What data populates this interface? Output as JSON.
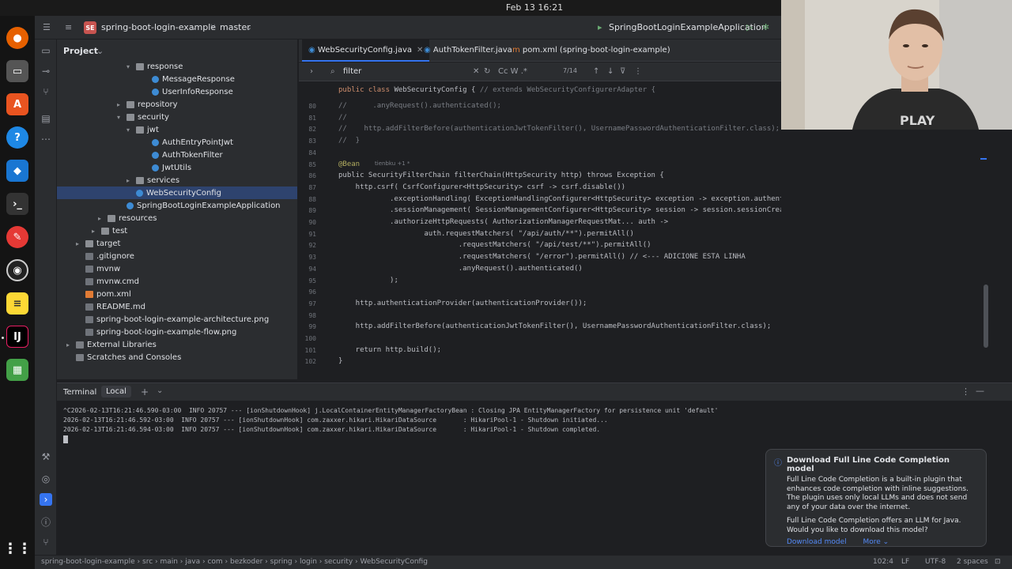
{
  "system": {
    "clock": "Feb 13  16:21"
  },
  "header": {
    "project_badge": "SE",
    "project_name": "spring-boot-login-example",
    "branch": "master",
    "run_config": "SpringBootLoginExampleApplication"
  },
  "project_panel": {
    "title": "Project",
    "items": [
      {
        "label": "response",
        "kind": "folder",
        "arrow": "▾"
      },
      {
        "label": "MessageResponse",
        "kind": "cls",
        "arrow": ""
      },
      {
        "label": "UserInfoResponse",
        "kind": "cls",
        "arrow": ""
      },
      {
        "label": "repository",
        "kind": "folder",
        "arrow": "▸"
      },
      {
        "label": "security",
        "kind": "folder",
        "arrow": "▾"
      },
      {
        "label": "jwt",
        "kind": "folder",
        "arrow": "▾"
      },
      {
        "label": "AuthEntryPointJwt",
        "kind": "cls",
        "arrow": ""
      },
      {
        "label": "AuthTokenFilter",
        "kind": "cls",
        "arrow": ""
      },
      {
        "label": "JwtUtils",
        "kind": "cls",
        "arrow": ""
      },
      {
        "label": "services",
        "kind": "folder",
        "arrow": "▸"
      },
      {
        "label": "WebSecurityConfig",
        "kind": "cls",
        "arrow": "",
        "selected": true
      },
      {
        "label": "SpringBootLoginExampleApplication",
        "kind": "cls",
        "arrow": ""
      },
      {
        "label": "resources",
        "kind": "folder",
        "arrow": "▸"
      },
      {
        "label": "test",
        "kind": "folder",
        "arrow": "▸"
      },
      {
        "label": "target",
        "kind": "folder",
        "arrow": "▸"
      },
      {
        "label": ".gitignore",
        "kind": "file",
        "arrow": ""
      },
      {
        "label": "mvnw",
        "kind": "file",
        "arrow": ""
      },
      {
        "label": "mvnw.cmd",
        "kind": "file",
        "arrow": ""
      },
      {
        "label": "pom.xml",
        "kind": "xml",
        "arrow": ""
      },
      {
        "label": "README.md",
        "kind": "file",
        "arrow": ""
      },
      {
        "label": "spring-boot-login-example-architecture.png",
        "kind": "file",
        "arrow": ""
      },
      {
        "label": "spring-boot-login-example-flow.png",
        "kind": "file",
        "arrow": ""
      },
      {
        "label": "External Libraries",
        "kind": "lib",
        "arrow": "▸"
      },
      {
        "label": "Scratches and Consoles",
        "kind": "lib",
        "arrow": ""
      }
    ]
  },
  "tabs": [
    {
      "label": "WebSecurityConfig.java",
      "active": true
    },
    {
      "label": "AuthTokenFilter.java",
      "active": false
    },
    {
      "label": "pom.xml (spring-boot-login-example)",
      "active": false
    }
  ],
  "find": {
    "query": "filter",
    "count": "7/14",
    "opts": "Cc  W  .*"
  },
  "editor": {
    "header_line": "public class WebSecurityConfig { // extends WebSecurityConfigurerAdapter {",
    "author_hint": "tienbku +1 *",
    "lines": [
      {
        "n": "80",
        "t": "//      .anyRequest().authenticated();"
      },
      {
        "n": "81",
        "t": "//"
      },
      {
        "n": "82",
        "t": "//    http.addFilterBefore(authenticationJwtTokenFilter(), UsernamePasswordAuthenticationFilter.class);"
      },
      {
        "n": "83",
        "t": "//  }"
      },
      {
        "n": "84",
        "t": ""
      },
      {
        "n": "85",
        "t": "@Bean"
      },
      {
        "n": "86",
        "t": "public SecurityFilterChain filterChain(HttpSecurity http) throws Exception {"
      },
      {
        "n": "87",
        "t": "    http.csrf( CsrfConfigurer<HttpSecurity> csrf -> csrf.disable())"
      },
      {
        "n": "88",
        "t": "            .exceptionHandling( ExceptionHandlingConfigurer<HttpSecurity> exception -> exception.authenticationEntryPoint(unauthorizedHandler))"
      },
      {
        "n": "89",
        "t": "            .sessionManagement( SessionManagementConfigurer<HttpSecurity> session -> session.sessionCreationPolicy(SessionCreationPolicy.STATELESS))"
      },
      {
        "n": "90",
        "t": "            .authorizeHttpRequests( AuthorizationManagerRequestMat... auth ->"
      },
      {
        "n": "91",
        "t": "                    auth.requestMatchers( \"/api/auth/**\").permitAll()"
      },
      {
        "n": "92",
        "t": "                            .requestMatchers( \"/api/test/**\").permitAll()"
      },
      {
        "n": "93",
        "t": "                            .requestMatchers( \"/error\").permitAll() // <--- ADICIONE ESTA LINHA"
      },
      {
        "n": "94",
        "t": "                            .anyRequest().authenticated()"
      },
      {
        "n": "95",
        "t": "            );"
      },
      {
        "n": "96",
        "t": ""
      },
      {
        "n": "97",
        "t": "    http.authenticationProvider(authenticationProvider());"
      },
      {
        "n": "98",
        "t": ""
      },
      {
        "n": "99",
        "t": "    http.addFilterBefore(authenticationJwtTokenFilter(), UsernamePasswordAuthenticationFilter.class);"
      },
      {
        "n": "100",
        "t": ""
      },
      {
        "n": "101",
        "t": "    return http.build();"
      },
      {
        "n": "102",
        "t": "}"
      }
    ]
  },
  "terminal": {
    "tab_label": "Terminal",
    "local_label": "Local",
    "lines": [
      "^C2026-02-13T16:21:46.590-03:00  INFO 20757 --- [ionShutdownHook] j.LocalContainerEntityManagerFactoryBean : Closing JPA EntityManagerFactory for persistence unit 'default'",
      "2026-02-13T16:21:46.592-03:00  INFO 20757 --- [ionShutdownHook] com.zaxxer.hikari.HikariDataSource       : HikariPool-1 - Shutdown initiated...",
      "2026-02-13T16:21:46.594-03:00  INFO 20757 --- [ionShutdownHook] com.zaxxer.hikari.HikariDataSource       : HikariPool-1 - Shutdown completed."
    ]
  },
  "notification": {
    "title": "Download Full Line Code Completion model",
    "body1": "Full Line Code Completion is a built-in plugin that enhances code completion with inline suggestions. The plugin uses only local LLMs and does not send any of your data over the internet.",
    "body2": "Full Line Code Completion offers an LLM for Java. Would you like to download this model?",
    "download": "Download model",
    "more": "More ⌄"
  },
  "statusbar": {
    "breadcrumb": "spring-boot-login-example  ›  src  ›  main  ›  java  ›  com  ›  bezkoder  ›  spring  ›  login  ›  security  ›  WebSecurityConfig",
    "position": "102:4",
    "line_sep": "LF",
    "encoding": "UTF-8",
    "indent": "2 spaces"
  }
}
